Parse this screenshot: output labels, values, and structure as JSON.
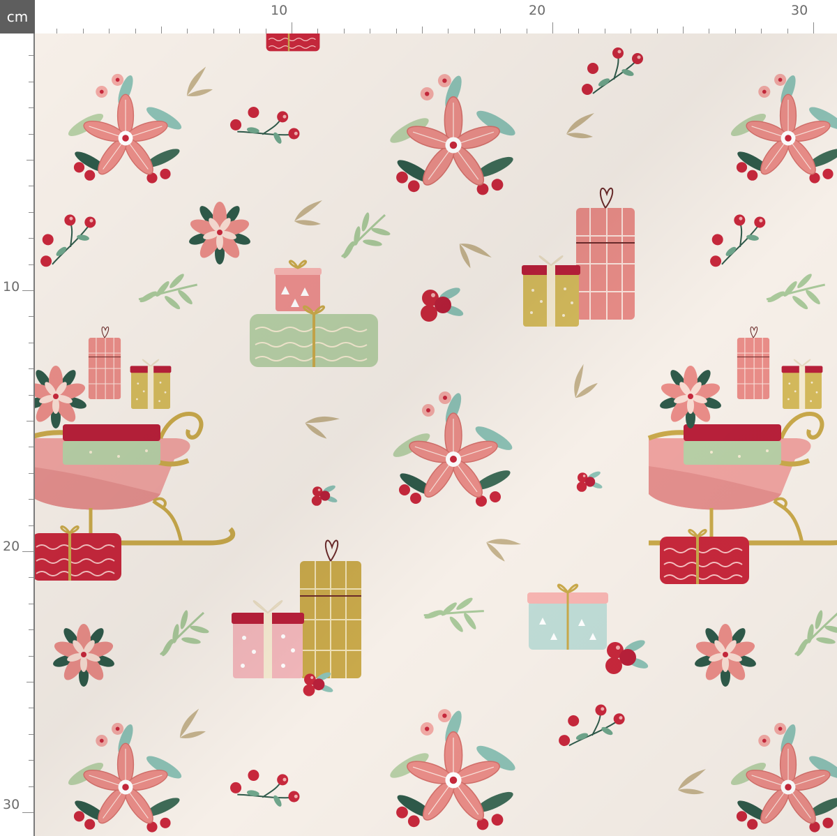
{
  "ruler": {
    "unit": "cm",
    "top_labels": [
      "10",
      "20",
      "30"
    ],
    "left_labels": [
      "10",
      "20",
      "30"
    ]
  },
  "colors": {
    "fabric_background": "#f6efe8",
    "coral_pink": "#e98d88",
    "berry_red": "#c7283c",
    "sage_green": "#b7cfa6",
    "mint": "#bfdcd6",
    "gold": "#c9a94b",
    "deep_green": "#2f5a4a"
  },
  "motifs": [
    "poinsettia-icon",
    "gift-box-icon",
    "sleigh-icon",
    "berry-sprig-icon",
    "leaf-sprig-icon"
  ]
}
